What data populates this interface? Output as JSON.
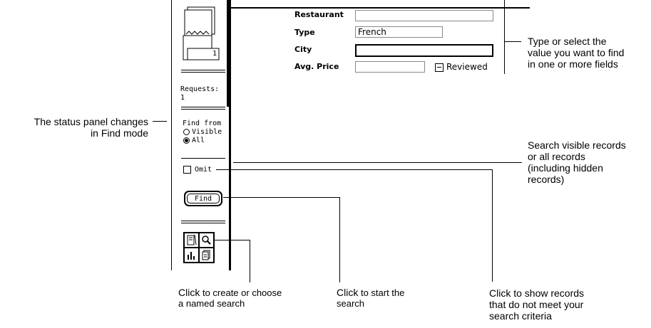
{
  "status_panel": {
    "record_number": "1",
    "requests_label": "Requests:",
    "requests_count": "1",
    "find_from_label": "Find from",
    "radio_visible": "Visible",
    "radio_all": "All",
    "omit_label": "Omit",
    "find_button": "Find"
  },
  "form": {
    "restaurant_label": "Restaurant",
    "restaurant_value": "",
    "type_label": "Type",
    "type_value": "French",
    "city_label": "City",
    "city_value": "",
    "avg_price_label": "Avg. Price",
    "avg_price_value": "",
    "reviewed_label": "Reviewed"
  },
  "callouts": {
    "type_select_1": "Type or select the",
    "type_select_2": "value you want to find",
    "type_select_3": "in one or more fields",
    "status_1": "The status panel changes",
    "status_2": "in Find mode",
    "search_visible_1": "Search visible records",
    "search_visible_2": "or all records",
    "search_visible_3": "(including hidden",
    "search_visible_4": "records)",
    "named_search_1a": "Click",
    "named_search_1b": " to create or choose",
    "named_search_2": "a named search",
    "start_search_1a": "Click",
    "start_search_1b": " to start the",
    "start_search_2": "search",
    "omit_1": "Click to show records",
    "omit_2": "that do not meet your",
    "omit_3": "search criteria"
  }
}
